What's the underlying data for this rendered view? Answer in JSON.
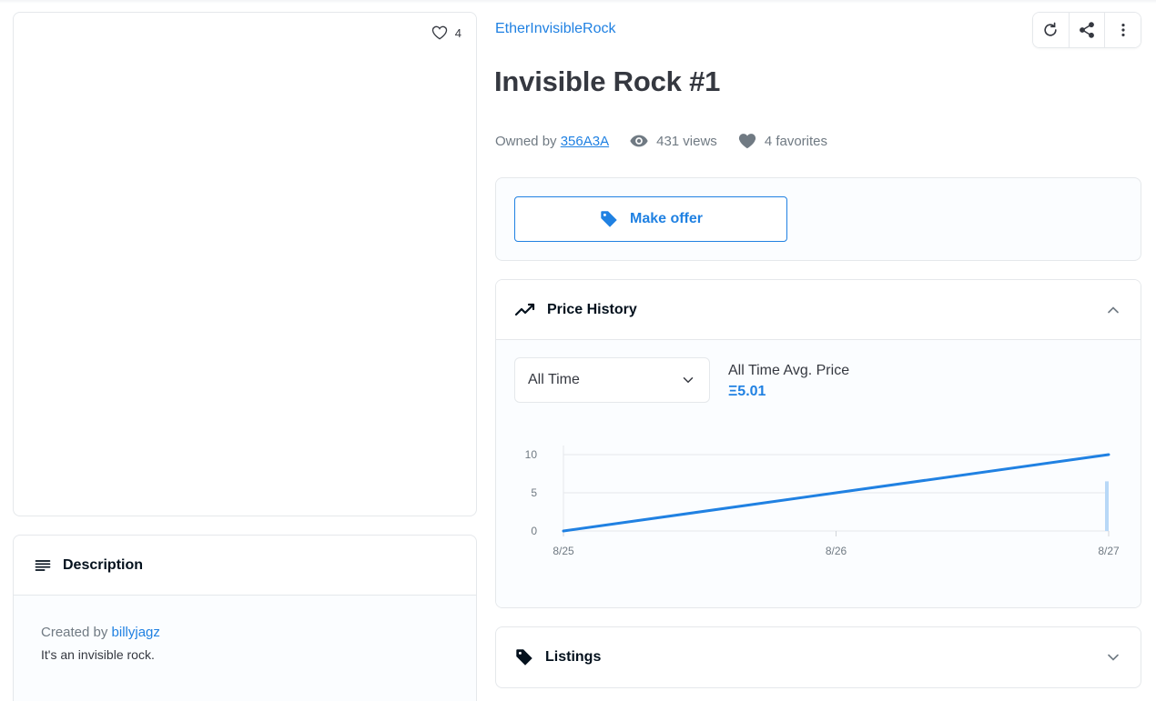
{
  "asset": {
    "favorites_count": "4",
    "collection_name": "EtherInvisibleRock",
    "title": "Invisible Rock #1",
    "owned_by_label": "Owned by",
    "owner": "356A3A",
    "views": "431 views",
    "favorites": "4 favorites"
  },
  "offer": {
    "button_label": "Make offer"
  },
  "description": {
    "header": "Description",
    "created_by_label": "Created by",
    "creator": "billyjagz",
    "text": "It's an invisible rock."
  },
  "price_history": {
    "header": "Price History",
    "range_selected": "All Time",
    "avg_label": "All Time Avg. Price",
    "avg_value": "Ξ5.01"
  },
  "listings": {
    "header": "Listings"
  },
  "colors": {
    "accent": "#2081e2",
    "text": "#353840",
    "border": "#e5e8eb"
  },
  "icons": {
    "favorite": "heart-outline-icon",
    "refresh": "refresh-icon",
    "share": "share-icon",
    "more": "more-vertical-icon",
    "views": "eye-icon",
    "favorites": "heart-filled-icon",
    "offer": "tag-icon",
    "price_history": "trending-icon",
    "description": "notes-icon",
    "listings": "tag-icon"
  },
  "chart_data": {
    "type": "line",
    "x": [
      "8/25",
      "8/26",
      "8/27"
    ],
    "x_ticks": [
      "8/25",
      "8/26",
      "8/27"
    ],
    "y_ticks": [
      "0",
      "5",
      "10"
    ],
    "ylim": [
      0,
      10
    ],
    "series": [
      {
        "values": [
          0,
          5,
          10
        ]
      }
    ],
    "volume": [
      {
        "x": "8/27",
        "value": 6.5
      }
    ],
    "grid": true
  }
}
